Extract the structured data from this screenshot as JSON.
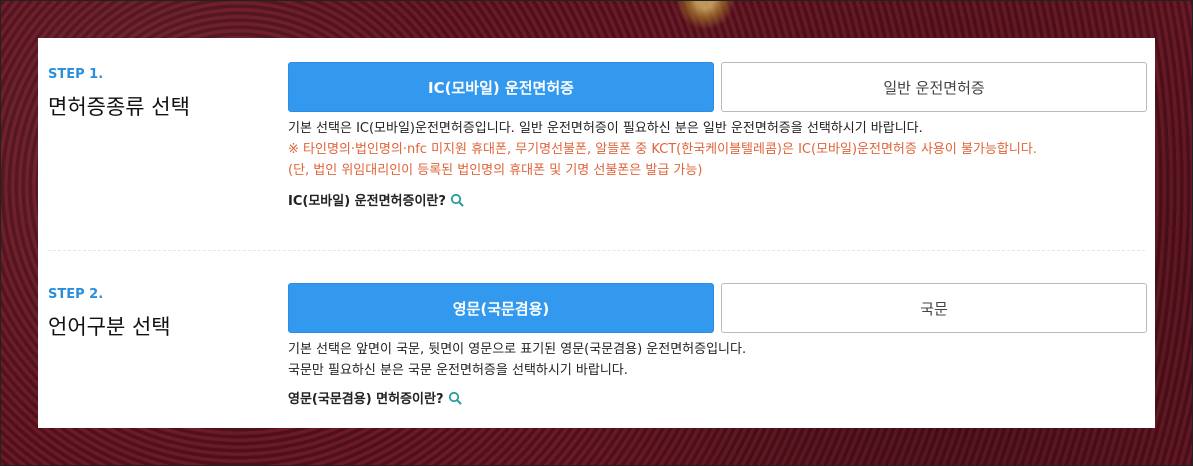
{
  "step1": {
    "label": "STEP 1.",
    "title": "면허증종류 선택",
    "options": [
      "IC(모바일) 운전면허증",
      "일반 운전면허증"
    ],
    "selected": "IC(모바일) 운전면허증",
    "desc": "기본 선택은 IC(모바일)운전면허증입니다. 일반 운전면허증이 필요하신 분은 일반 운전면허증을 선택하시기 바랍니다.",
    "warning1": "※ 타인명의·법인명의·nfc 미지원 휴대폰, 무기명선불폰, 알뜰폰 중 KCT(한국케이블텔레콤)은 IC(모바일)운전면허증 사용이 불가능합니다.",
    "warning2": "(단, 법인 위임대리인이 등록된 법인명의 휴대폰 및 기명 선불폰은 발급 가능)",
    "info_link": "IC(모바일) 운전면허증이란?"
  },
  "step2": {
    "label": "STEP 2.",
    "title": "언어구분 선택",
    "options": [
      "영문(국문겸용)",
      "국문"
    ],
    "selected": "영문(국문겸용)",
    "desc1": "기본 선택은 앞면이 국문, 뒷면이 영문으로 표기된 영문(국문겸용) 운전면허증입니다.",
    "desc2": "국문만 필요하신 분은 국문 운전면허증을 선택하시기 바랍니다.",
    "info_link": "영문(국문겸용) 면허증이란?"
  },
  "colors": {
    "accent": "#3399ee",
    "step_label": "#2a8fdb",
    "warning": "#e0643a"
  },
  "icons": {
    "info": "search-icon"
  }
}
